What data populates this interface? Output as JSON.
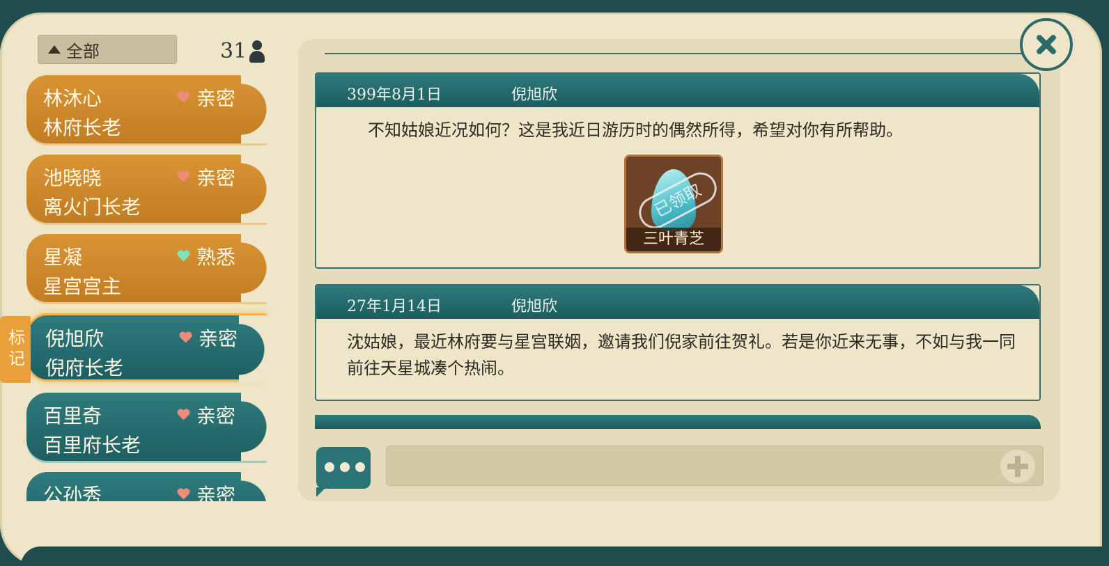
{
  "filter": {
    "label": "全部"
  },
  "contact_count": "31",
  "contacts": [
    {
      "name": "林沐心",
      "title": "林府长老",
      "relation": "亲密"
    },
    {
      "name": "池晓晓",
      "title": "离火门长老",
      "relation": "亲密"
    },
    {
      "name": "星凝",
      "title": "星宫宫主",
      "relation": "熟悉"
    },
    {
      "name": "倪旭欣",
      "title": "倪府长老",
      "relation": "亲密"
    },
    {
      "name": "百里奇",
      "title": "百里府长老",
      "relation": "亲密"
    },
    {
      "name": "公孙秀",
      "title": "",
      "relation": "亲密"
    }
  ],
  "mark_tab": "标记",
  "messages": [
    {
      "date": "399年8月1日",
      "sender": "倪旭欣",
      "text": "不知姑娘近况如何？这是我近日游历时的偶然所得，希望对你有所帮助。",
      "reward": {
        "name": "三叶青芝",
        "stamp": "已领取"
      }
    },
    {
      "date": "27年1月14日",
      "sender": "倪旭欣",
      "text": "沈姑娘，最近林府要与星宫联姻，邀请我们倪家前往贺礼。若是你近来无事，不如与我一同前往天星城凑个热闹。"
    }
  ],
  "icons": {
    "close": "close-icon",
    "chat": "chat-bubble-icon",
    "plus": "plus-icon",
    "person": "person-icon",
    "heart": "heart-icon"
  },
  "colors": {
    "heart_close": "#f08a7a",
    "heart_familiar": "#7fe3b6",
    "card_orange": "#d08a2c",
    "card_teal": "#2a7072"
  }
}
